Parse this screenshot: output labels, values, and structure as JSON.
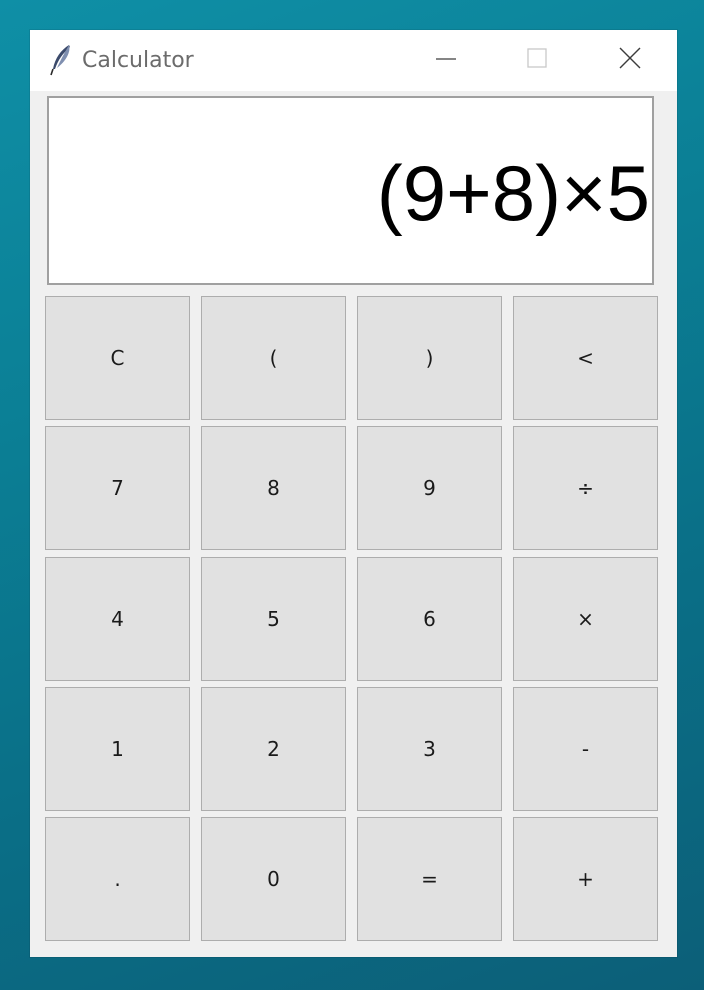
{
  "window": {
    "title": "Calculator",
    "icon": "feather-icon",
    "controls": [
      "minimize-icon",
      "maximize-icon",
      "close-icon"
    ]
  },
  "display": {
    "expression": "(9+8)×5"
  },
  "keypad": {
    "rows": [
      [
        "C",
        "(",
        ")",
        "<"
      ],
      [
        "7",
        "8",
        "9",
        "÷"
      ],
      [
        "4",
        "5",
        "6",
        "×"
      ],
      [
        "1",
        "2",
        "3",
        "-"
      ],
      [
        ".",
        "0",
        "=",
        "+"
      ]
    ]
  }
}
